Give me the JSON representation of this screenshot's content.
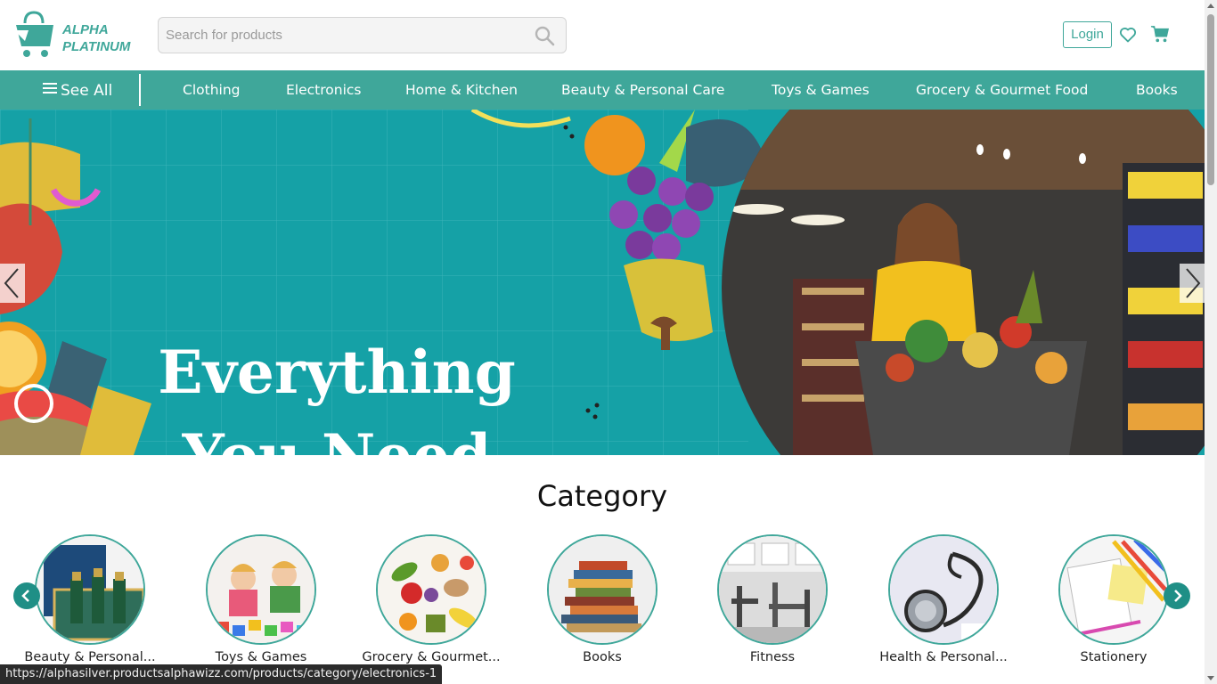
{
  "header": {
    "logo": {
      "line1": "ALPHA",
      "line2": "PLATINUM"
    },
    "search": {
      "placeholder": "Search for products",
      "value": ""
    },
    "login_label": "Login"
  },
  "nav": {
    "see_all_label": "See All",
    "items": [
      "Clothing",
      "Electronics",
      "Home & Kitchen",
      "Beauty & Personal Care",
      "Toys & Games",
      "Grocery & Gourmet Food",
      "Books"
    ]
  },
  "banner": {
    "line1": "Everything",
    "line2": "You Need"
  },
  "category": {
    "title": "Category",
    "items": [
      {
        "label": "Beauty & Personal...",
        "icon": "cosmetics-image"
      },
      {
        "label": "Toys & Games",
        "icon": "toys-image"
      },
      {
        "label": "Grocery & Gourmet...",
        "icon": "vegetables-image"
      },
      {
        "label": "Books",
        "icon": "books-image"
      },
      {
        "label": "Fitness",
        "icon": "gym-image"
      },
      {
        "label": "Health & Personal...",
        "icon": "stethoscope-image"
      },
      {
        "label": "Stationery",
        "icon": "stationery-image"
      }
    ]
  },
  "status_url": "https://alphasilver.productsalphawizz.com/products/category/electronics-1",
  "colors": {
    "brand": "#3fa79a",
    "banner_bg": "#15a1a6",
    "arrow": "#1f8f86"
  }
}
